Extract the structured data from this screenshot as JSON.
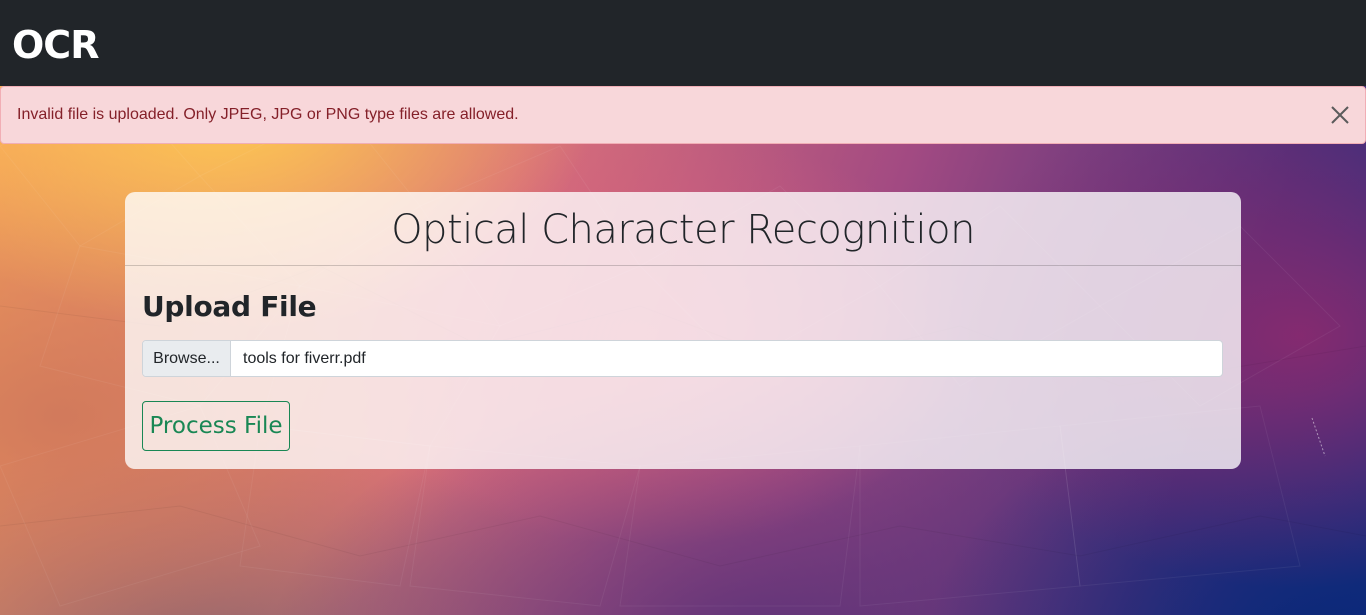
{
  "navbar": {
    "brand": "OCR"
  },
  "alert": {
    "message": "Invalid file is uploaded. Only JPEG, JPG or PNG type files are allowed.",
    "close_icon": "close-icon",
    "colors": {
      "background": "#f8d7da",
      "text": "#842029",
      "border": "#f1aeb5"
    }
  },
  "card": {
    "title": "Optical Character Recognition",
    "upload_title": "Upload File",
    "file_input": {
      "browse_label": "Browse...",
      "file_name": "tools for fiverr.pdf"
    },
    "process_button": "Process File",
    "colors": {
      "button": "#198754"
    }
  },
  "theme": {
    "navbar_background": "#212529"
  }
}
